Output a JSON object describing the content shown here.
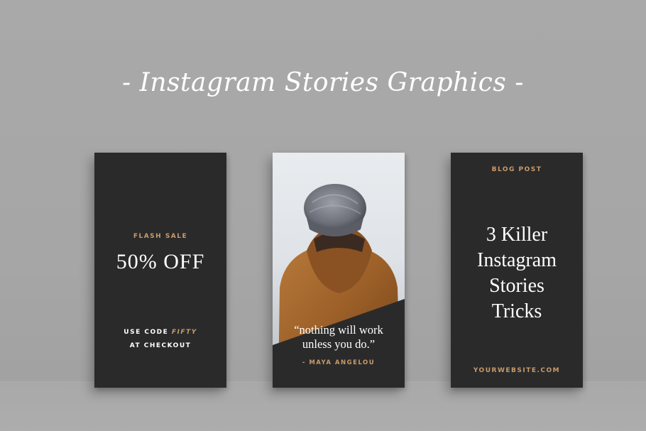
{
  "headline": "- Instagram Stories Graphics -",
  "cards": {
    "sale": {
      "label": "FLASH SALE",
      "offer": "50% OFF",
      "code_prefix": "USE CODE",
      "code": "FIFTY",
      "code_suffix": "AT CHECKOUT"
    },
    "quote": {
      "text_line1": "“nothing will work",
      "text_line2": "unless you do.”",
      "author": "- MAYA ANGELOU"
    },
    "blog": {
      "label": "BLOG POST",
      "title_lines": [
        "3 Killer",
        "Instagram",
        "Stories",
        "Tricks"
      ],
      "website": "YOURWEBSITE.COM"
    }
  },
  "colors": {
    "background": "#a8a8a8",
    "card": "#2b2a2b",
    "accent_gold": "#c89b6b",
    "text": "#ffffff"
  }
}
